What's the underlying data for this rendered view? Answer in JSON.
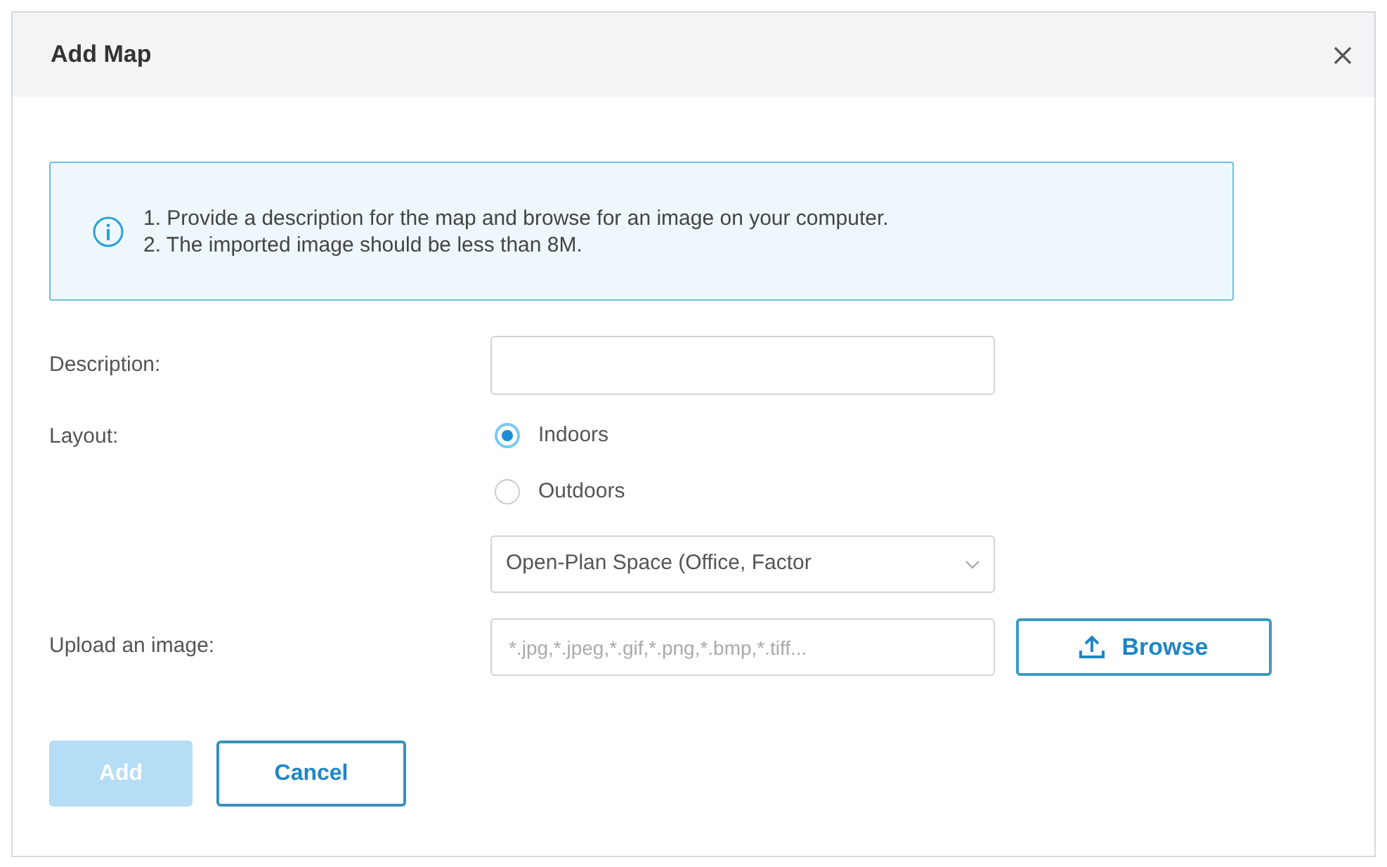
{
  "dialog": {
    "title": "Add Map"
  },
  "info": {
    "lines": [
      "1. Provide a description for the map and browse for an image on your computer.",
      "2. The imported image should be less than 8M."
    ]
  },
  "description": {
    "label": "Description:"
  },
  "layout": {
    "label": "Layout:",
    "options": [
      {
        "label": "Indoors",
        "selected": true
      },
      {
        "label": "Outdoors",
        "selected": false
      }
    ],
    "environment_select": {
      "value": "Open-Plan Space (Office, Factor"
    }
  },
  "upload": {
    "label": "Upload an image:",
    "placeholder": "*.jpg,*.jpeg,*.gif,*.png,*.bmp,*.tiff...",
    "browse_button": "Browse"
  },
  "buttons": [
    {
      "label": "Add",
      "kind": "primary",
      "disabled": true
    },
    {
      "label": "Cancel",
      "kind": "secondary",
      "disabled": false
    }
  ]
}
